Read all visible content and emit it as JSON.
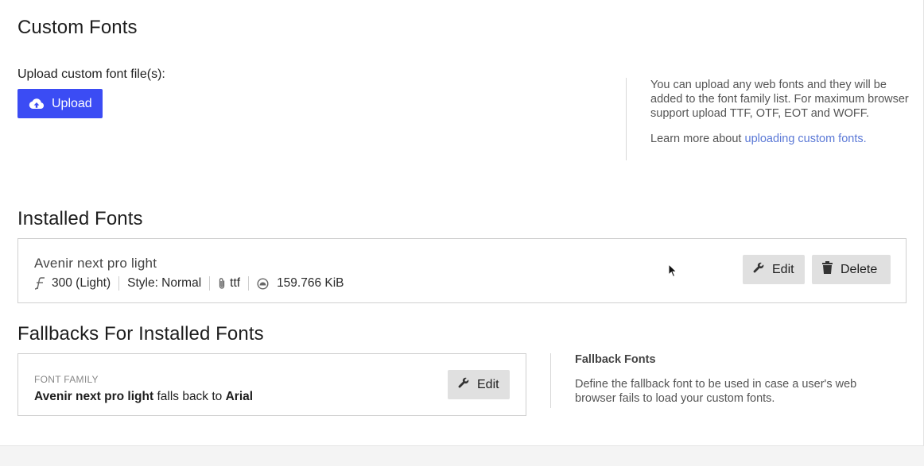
{
  "custom_fonts": {
    "title": "Custom Fonts",
    "upload_label": "Upload custom font file(s):",
    "upload_button": "Upload",
    "upload_icon": "cloud-upload-icon",
    "info_text": "You can upload any web fonts and they will be added to the font family list. For maximum browser support upload TTF, OTF, EOT and WOFF.",
    "learn_more_prefix": "Learn more about ",
    "learn_more_link": "uploading custom fonts."
  },
  "installed_fonts": {
    "title": "Installed Fonts",
    "fonts": [
      {
        "name": "Avenir next pro light",
        "weight": "300 (Light)",
        "style": "Style: Normal",
        "format": "ttf",
        "size": "159.766 KiB",
        "edit_label": "Edit",
        "delete_label": "Delete"
      }
    ]
  },
  "fallbacks": {
    "title": "Fallbacks For Installed Fonts",
    "field_label": "FONT FAMILY",
    "font_name": "Avenir next pro light",
    "falls_back_text": " falls back to ",
    "fallback_font": "Arial",
    "edit_label": "Edit",
    "info_title": "Fallback Fonts",
    "info_text": "Define the fallback font to be used in case a user's web browser fails to load your custom fonts."
  },
  "colors": {
    "primary": "#3b4cf4",
    "link": "#5a78d6",
    "button_gray": "#e0e0e0"
  }
}
